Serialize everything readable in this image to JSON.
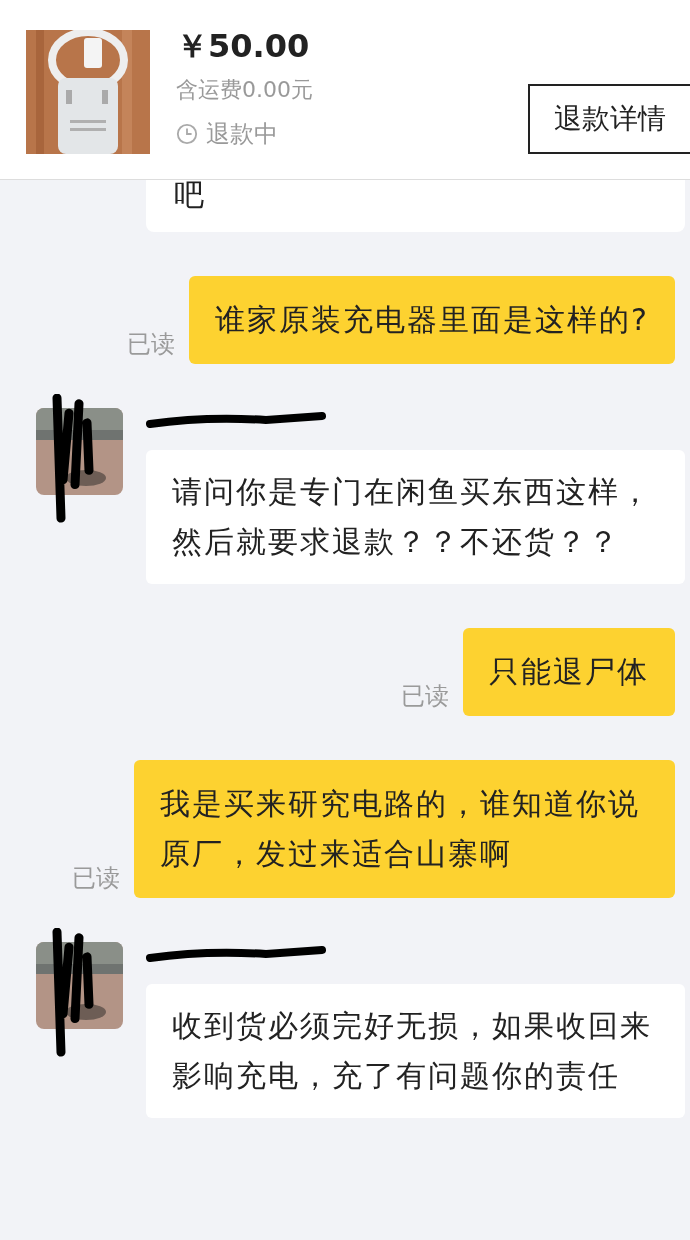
{
  "header": {
    "price": "￥50.00",
    "shipping": "含运费0.00元",
    "status": "退款中",
    "button": "退款详情"
  },
  "messages": [
    {
      "kind": "partial",
      "text": "吧"
    },
    {
      "kind": "sent",
      "text": "谁家原装充电器里面是这样的?",
      "receipt": "已读"
    },
    {
      "kind": "received",
      "text": "请问你是专门在闲鱼买东西这样，然后就要求退款？？不还货？？"
    },
    {
      "kind": "sent",
      "text": "只能退尸体",
      "receipt": "已读"
    },
    {
      "kind": "sent",
      "text": "我是买来研究电路的，谁知道你说原厂，发过来适合山寨啊",
      "receipt": "已读"
    },
    {
      "kind": "received",
      "text": "收到货必须完好无损，如果收回来影响充电，充了有问题你的责任"
    }
  ]
}
